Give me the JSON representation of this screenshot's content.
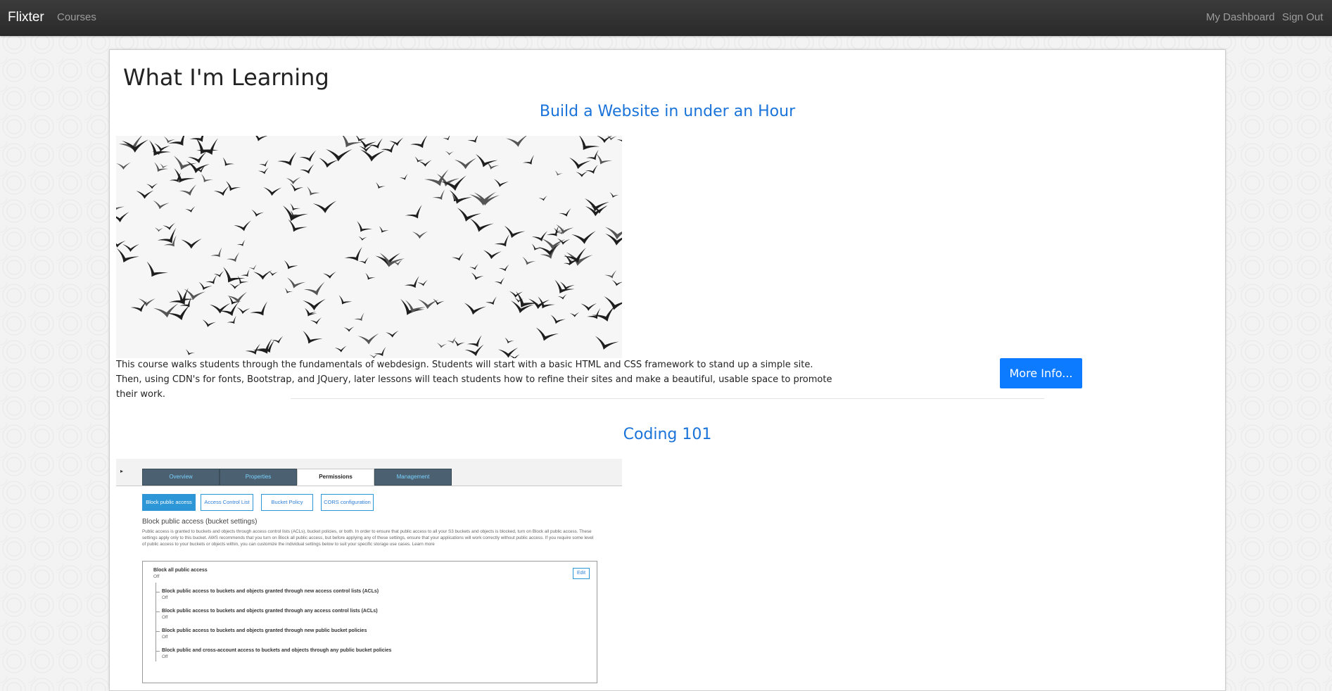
{
  "navbar": {
    "brand": "Flixter",
    "courses_link": "Courses",
    "dashboard_link": "My Dashboard",
    "signout_link": "Sign Out"
  },
  "page": {
    "title": "What I'm Learning"
  },
  "courses": [
    {
      "title": "Build a Website in under an Hour",
      "description": "This course walks students through the fundamentals of webdesign. Students will start with a basic HTML and CSS framework to stand up a simple site. Then, using CDN's for fonts, Bootstrap, and JQuery, later lessons will teach students how to refine their sites and make a beautiful, usable space to promote their work.",
      "button_label": "More Info...",
      "image_icon": "birds-flock-image"
    },
    {
      "title": "Coding 101",
      "image_icon": "aws-s3-permissions-screenshot",
      "image_text": {
        "tabs": [
          "Overview",
          "Properties",
          "Permissions",
          "Management"
        ],
        "buttons": [
          "Block public access",
          "Access Control List",
          "Bucket Policy",
          "CORS configuration"
        ],
        "heading": "Block public access (bucket settings)",
        "paragraph": "Public access is granted to buckets and objects through access control lists (ACLs), bucket policies, or both. In order to ensure that public access to all your S3 buckets and objects is blocked, turn on Block all public access. These settings apply only to this bucket. AWS recommends that you turn on Block all public access, but before applying any of these settings, ensure that your applications will work correctly without public access. If you require some level of public access to your buckets or objects within, you can customize the individual settings below to suit your specific storage use cases. Learn more",
        "edit": "Edit",
        "rows": [
          {
            "title": "Block all public access",
            "status": "Off"
          },
          {
            "title": "Block public access to buckets and objects granted through new access control lists (ACLs)",
            "status": "Off"
          },
          {
            "title": "Block public access to buckets and objects granted through any access control lists (ACLs)",
            "status": "Off"
          },
          {
            "title": "Block public access to buckets and objects granted through new public bucket policies",
            "status": "Off"
          },
          {
            "title": "Block public and cross-account access to buckets and objects through any public bucket policies",
            "status": "Off"
          }
        ]
      }
    }
  ],
  "colors": {
    "navbar": "#2f2f2f",
    "link_blue": "#1a73d9",
    "button_blue": "#0d7bff"
  }
}
